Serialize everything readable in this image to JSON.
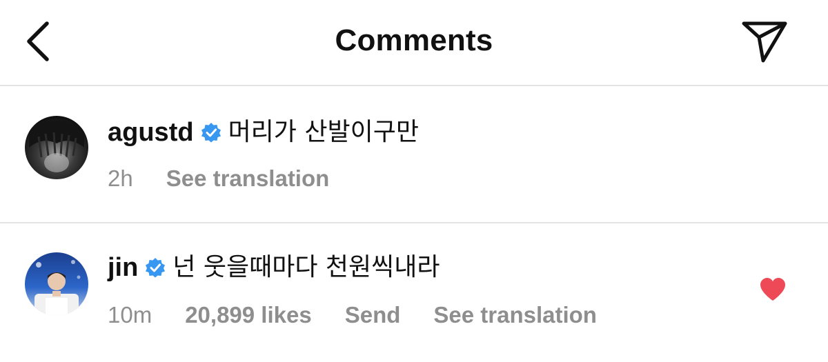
{
  "header": {
    "title": "Comments",
    "back_icon": "chevron-left-icon",
    "share_icon": "paper-plane-icon"
  },
  "comments": [
    {
      "username": "agustd",
      "verified": true,
      "text": "머리가 산발이구만",
      "time": "2h",
      "see_translation": "See translation"
    },
    {
      "username": "jin",
      "verified": true,
      "text": "넌 웃을때마다 천원씩내라",
      "time": "10m",
      "likes": "20,899 likes",
      "send": "Send",
      "see_translation": "See translation",
      "liked": true
    }
  ],
  "colors": {
    "verified_badge": "#3897f0",
    "meta_text": "#8e8e8e",
    "heart": "#ed4956",
    "divider": "#e3e3e3"
  }
}
